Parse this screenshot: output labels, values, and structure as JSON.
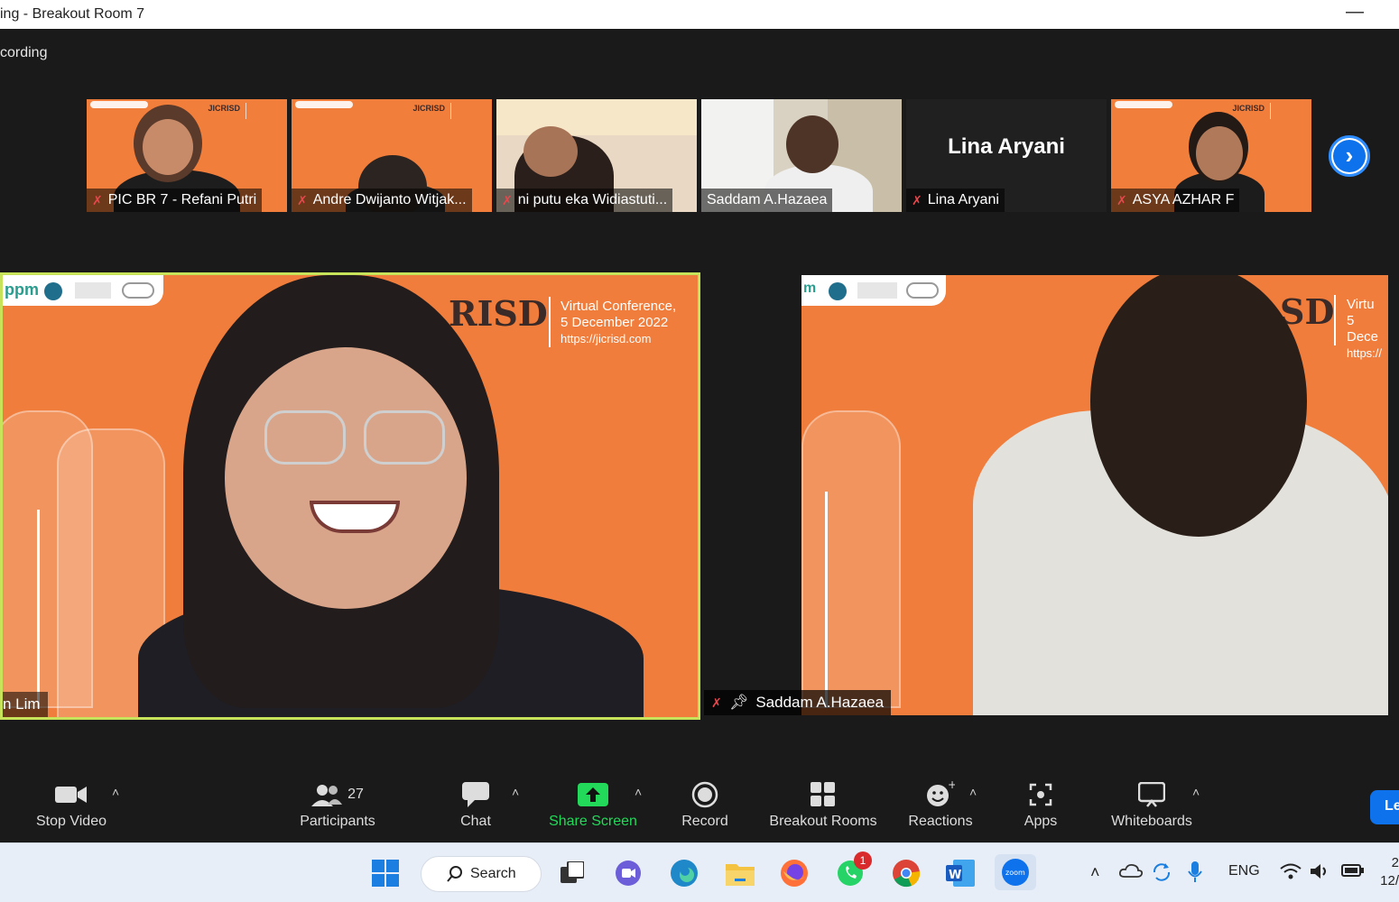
{
  "window": {
    "title": "ing - Breakout Room 7",
    "minimize_glyph": "—"
  },
  "meeting": {
    "recording_label": "cording",
    "gallery": [
      {
        "name": "PIC BR 7 - Refani Putri",
        "muted": true,
        "video": true,
        "mini_title": "JICRISD"
      },
      {
        "name": "Andre Dwijanto Witjak...",
        "muted": true,
        "video": true,
        "mini_title": "JICRISD"
      },
      {
        "name": "ni putu eka Widiastuti...",
        "muted": true,
        "video": true
      },
      {
        "name": "Saddam A.Hazaea",
        "muted": false,
        "video": true
      },
      {
        "name": "Lina Aryani",
        "muted": true,
        "video": false,
        "display_text": "Lina Aryani"
      },
      {
        "name": "ASYA AZHAR F",
        "muted": true,
        "video": true,
        "mini_title": "JICRISD"
      }
    ],
    "next_page_icon": "chevron-right-icon",
    "active_speaker": {
      "name": "n Lim",
      "background_title": "RISD",
      "conf_line1": "Virtual Conference,",
      "conf_line2": "5 December 2022",
      "conf_line3": "https://jicrisd.com",
      "logos_text": "ppm"
    },
    "pinned_speaker": {
      "name": "Saddam A.Hazaea",
      "background_title": "SD",
      "conf_line1": "Virtu",
      "conf_line2": "5 Dece",
      "conf_line3": "https://",
      "logos_text": "m"
    },
    "accent_colors": {
      "active_border": "#c7e35a",
      "background_orange": "#f07d3b",
      "zoom_blue": "#0e72ed",
      "share_green": "#23d959"
    }
  },
  "toolbar": {
    "stop_video": "Stop Video",
    "participants": "Participants",
    "participants_count": "27",
    "chat": "Chat",
    "share_screen": "Share Screen",
    "record": "Record",
    "breakout_rooms": "Breakout Rooms",
    "reactions": "Reactions",
    "apps": "Apps",
    "whiteboards": "Whiteboards",
    "leave": "Le"
  },
  "taskbar": {
    "search_label": "Search",
    "whatsapp_badge": "1",
    "language": "ENG",
    "clock_top": "2",
    "clock_bottom": "12/"
  }
}
